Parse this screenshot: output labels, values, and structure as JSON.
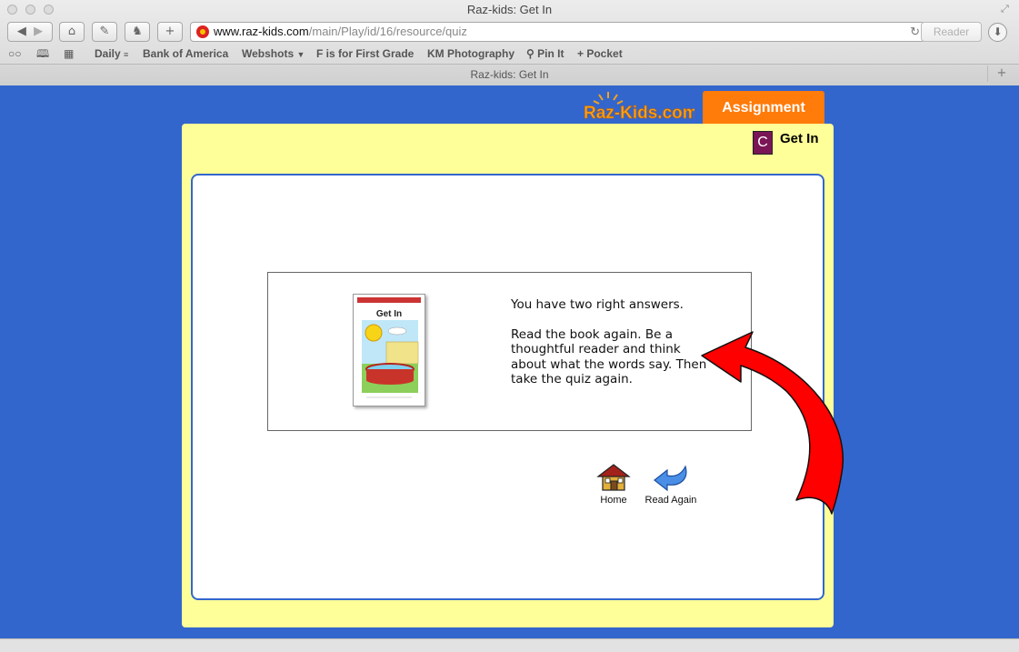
{
  "browser": {
    "window_title": "Raz-kids: Get In",
    "url_host": "www.raz-kids.com",
    "url_path": "/main/Play/id/16/resource/quiz",
    "reader_label": "Reader",
    "bookmarks": [
      "Daily",
      "Bank of America",
      "Webshots",
      "F is for First Grade",
      "KM Photography",
      "Pin It",
      "Pocket"
    ],
    "tab_title": "Raz-kids: Get In"
  },
  "header": {
    "logo_text": "Raz-Kids.com",
    "assignment_label": "Assignment",
    "level_letter": "C",
    "book_title": "Get In"
  },
  "result": {
    "cover_title": "Get In",
    "message_line1": "You have two right answers.",
    "message_line2": "Read the book again. Be a thoughtful reader and think about what the words say. Then take the quiz again."
  },
  "actions": {
    "home_label": "Home",
    "read_again_label": "Read Again"
  },
  "colors": {
    "page_background": "#3366cc",
    "panel_background": "#ffff99",
    "assignment_tab": "#ff7b0a",
    "level_badge": "#7a1656",
    "annotation_arrow": "#ff0000"
  }
}
